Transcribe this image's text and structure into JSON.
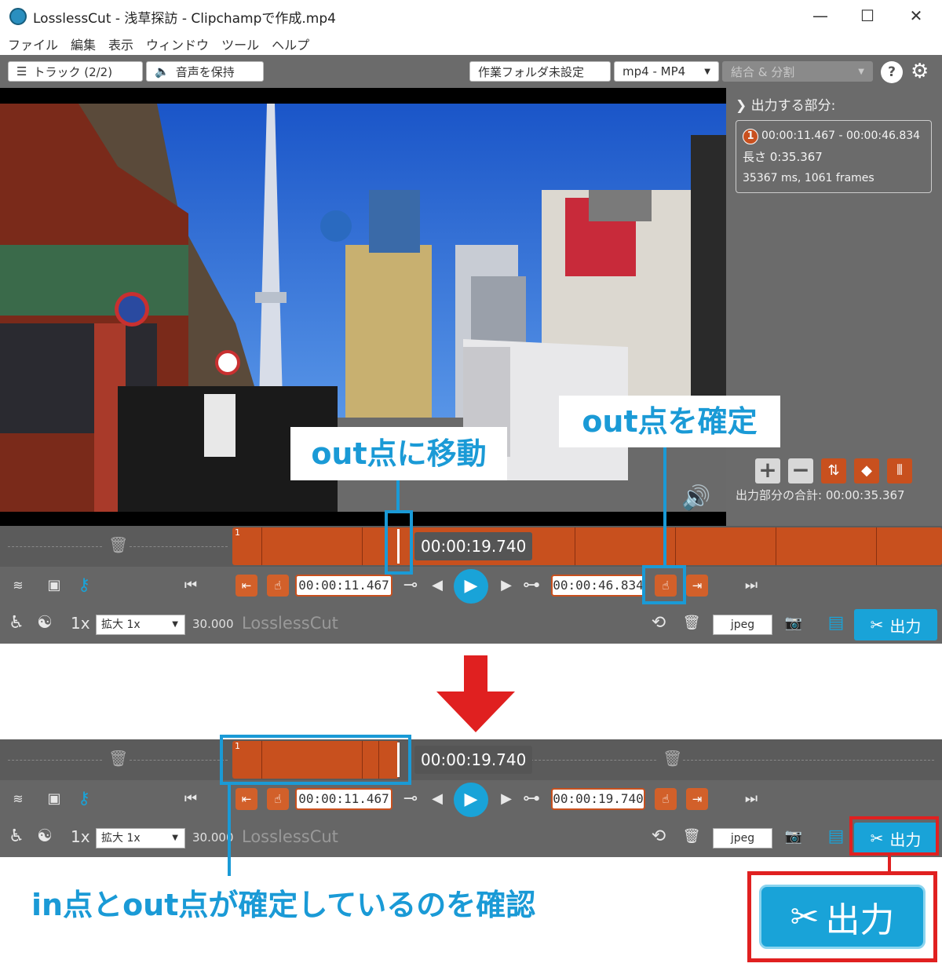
{
  "window": {
    "title": "LosslessCut - 浅草探訪 - Clipchampで作成.mp4",
    "min": "—",
    "max": "☐",
    "close": "✕"
  },
  "menu": [
    "ファイル",
    "編集",
    "表示",
    "ウィンドウ",
    "ツール",
    "ヘルプ"
  ],
  "toolbar": {
    "tracks_label": "トラック (2/2)",
    "keep_audio_label": "音声を保持",
    "workdir_label": "作業フォルダ未設定",
    "format_label": "mp4 - MP4",
    "mode_label": "結合 & 分割",
    "help_label": "?"
  },
  "sidebar": {
    "heading": "出力する部分:",
    "segment": {
      "number": "1",
      "range": "00:00:11.467 - 00:00:46.834",
      "length": "長さ 0:35.367",
      "frames": "35367 ms, 1061 frames"
    },
    "total": "出力部分の合計:  00:00:35.367"
  },
  "panel1": {
    "seg_number": "1",
    "current_time": "00:00:19.740",
    "in_time": "00:00:11.467",
    "out_time": "00:00:46.834",
    "speed": "1x",
    "zoom": "拡大 1x",
    "fps": "30.000",
    "app_name": "LosslessCut",
    "capture_format": "jpeg",
    "export_label": "出力"
  },
  "panel2": {
    "seg_number": "1",
    "current_time": "00:00:19.740",
    "in_time": "00:00:11.467",
    "out_time": "00:00:19.740",
    "speed": "1x",
    "zoom": "拡大 1x",
    "fps": "30.000",
    "app_name": "LosslessCut",
    "capture_format": "jpeg",
    "export_label": "出力"
  },
  "callouts": {
    "move_out": "out点に移動",
    "set_out": "out点を確定",
    "confirm": "in点とout点が確定しているのを確認",
    "big_export": "出力"
  },
  "colors": {
    "accent": "#19a3d8",
    "segment": "#c8501e",
    "arrow": "#e02020",
    "callout_text": "#1a9ad6"
  }
}
